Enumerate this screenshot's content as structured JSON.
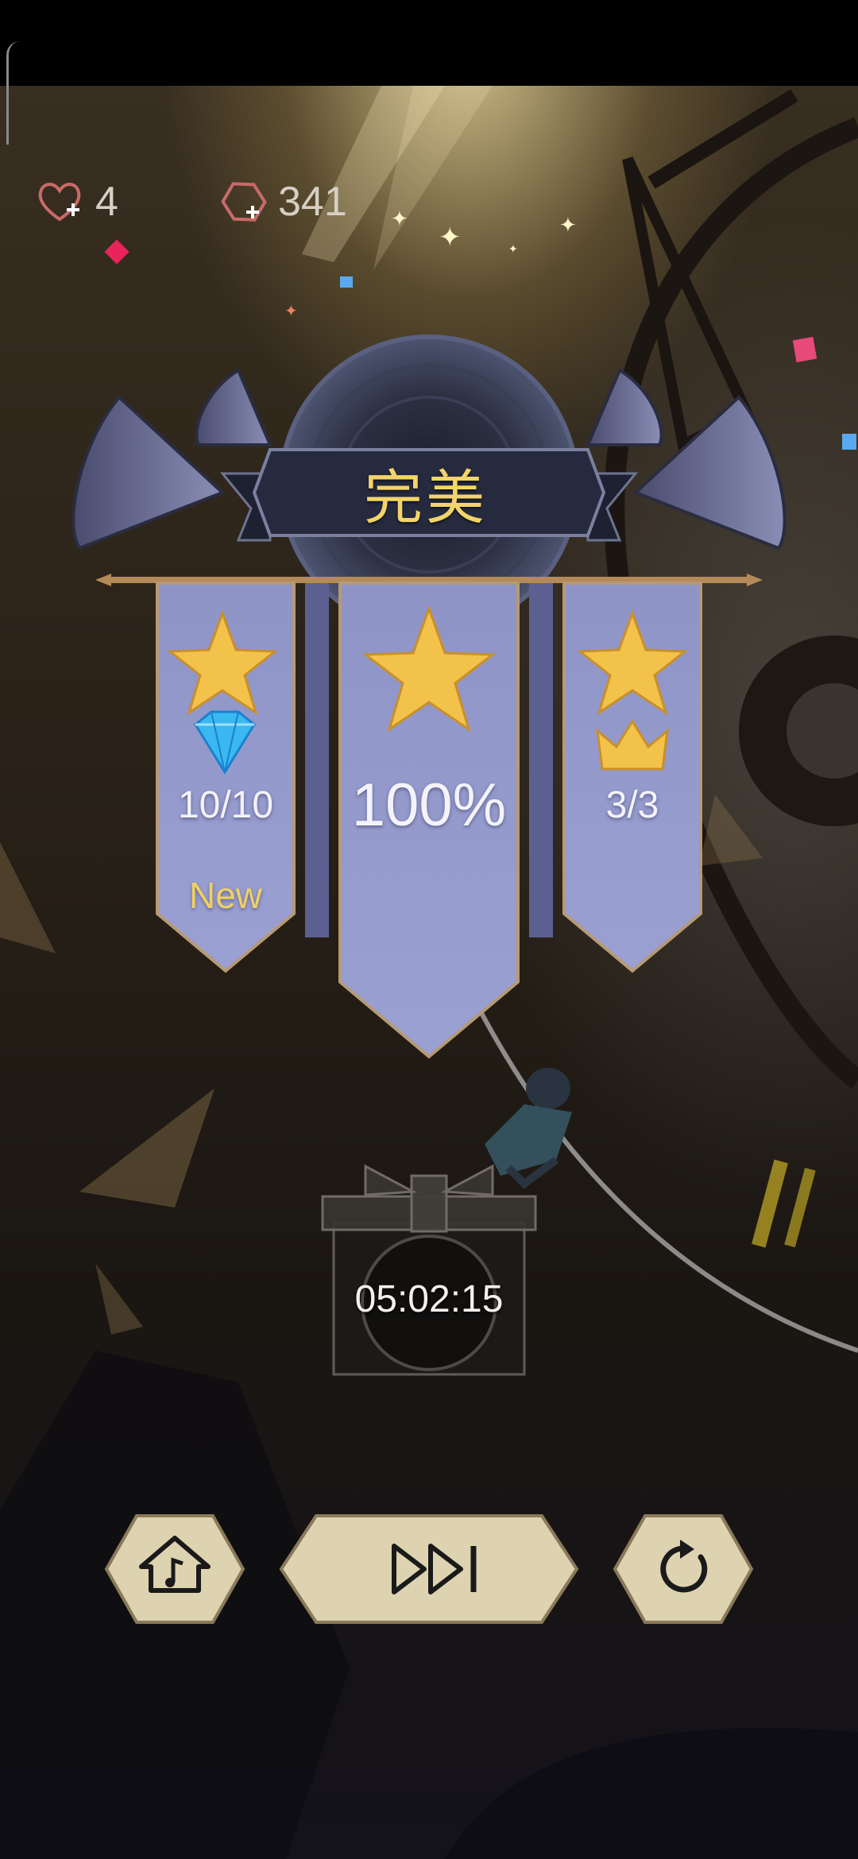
{
  "currency": {
    "lives": "4",
    "gems": "341"
  },
  "result": {
    "rank_title": "完美",
    "diamond_count": "10/10",
    "new_label": "New",
    "accuracy": "100%",
    "crown_count": "3/3"
  },
  "reward": {
    "countdown": "05:02:15"
  },
  "colors": {
    "gold_text": "#f2d46a",
    "pennant": "#8c92c4",
    "button": "#ddd3b0"
  },
  "icons": {
    "lives": "heart-plus-icon",
    "gems": "gem-plus-icon",
    "home": "home-music-icon",
    "next": "skip-forward-icon",
    "retry": "retry-icon"
  }
}
